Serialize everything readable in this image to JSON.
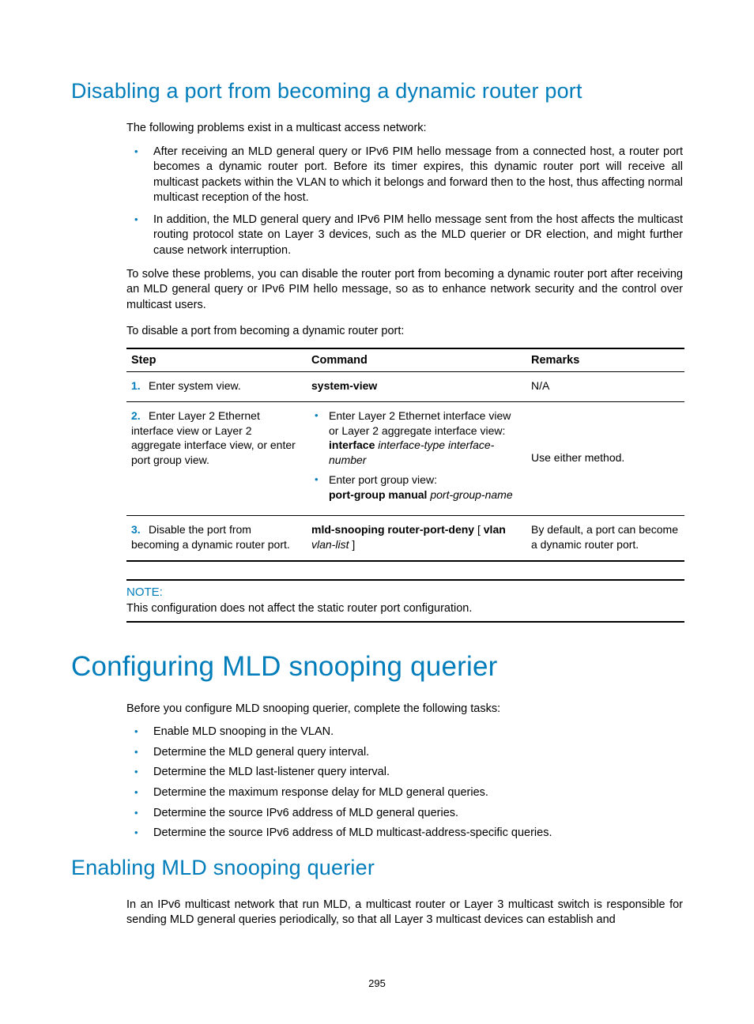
{
  "section1": {
    "heading": "Disabling a port from becoming a dynamic router port",
    "intro": "The following problems exist in a multicast access network:",
    "bullets": [
      "After receiving an MLD general query or IPv6 PIM hello message from a connected host, a router port becomes a dynamic router port. Before its timer expires, this dynamic router port will receive all multicast packets within the VLAN to which it belongs and forward then to the host, thus affecting normal multicast reception of the host.",
      "In addition, the MLD general query and IPv6 PIM hello message sent from the host affects the multicast routing protocol state on Layer 3 devices, such as the MLD querier or DR election, and might further cause network interruption."
    ],
    "solve": "To solve these problems, you can disable the router port from becoming a dynamic router port after receiving an MLD general query or IPv6 PIM hello message, so as to enhance network security and the control over multicast users.",
    "lead": "To disable a port from becoming a dynamic router port:"
  },
  "table": {
    "headers": {
      "step": "Step",
      "command": "Command",
      "remarks": "Remarks"
    },
    "rows": [
      {
        "num": "1.",
        "step": "Enter system view.",
        "cmd_bold": "system-view",
        "remarks": "N/A"
      },
      {
        "num": "2.",
        "step": "Enter Layer 2 Ethernet interface view or Layer 2 aggregate interface view, or enter port group view.",
        "b1_line1": "Enter Layer 2 Ethernet interface view or Layer 2 aggregate interface view:",
        "b1_cmd_bold": "interface",
        "b1_cmd_ital": "interface-type interface-number",
        "b2_line1": "Enter port group view:",
        "b2_cmd_bold": "port-group manual",
        "b2_cmd_ital": "port-group-name",
        "remarks": "Use either method."
      },
      {
        "num": "3.",
        "step": "Disable the port from becoming a dynamic router port.",
        "cmd_bold_a": "mld-snooping router-port-deny",
        "cmd_plain_a": " [ ",
        "cmd_bold_b": "vlan",
        "cmd_ital_a": "vlan-list",
        "cmd_plain_b": " ]",
        "remarks": "By default, a port can become a dynamic router port."
      }
    ]
  },
  "note": {
    "label": "NOTE:",
    "text": "This configuration does not affect the static router port configuration."
  },
  "section2": {
    "heading": "Configuring MLD snooping querier",
    "intro": "Before you configure MLD snooping querier, complete the following tasks:",
    "bullets": [
      "Enable MLD snooping in the VLAN.",
      "Determine the MLD general query interval.",
      "Determine the MLD last-listener query interval.",
      "Determine the maximum response delay for MLD general queries.",
      "Determine the source IPv6 address of MLD general queries.",
      "Determine the source IPv6 address of MLD multicast-address-specific queries."
    ]
  },
  "section3": {
    "heading": "Enabling MLD snooping querier",
    "para": "In an IPv6 multicast network that run MLD, a multicast router or Layer 3 multicast switch is responsible for sending MLD general queries periodically, so that all Layer 3 multicast devices can establish and"
  },
  "pageno": "295"
}
